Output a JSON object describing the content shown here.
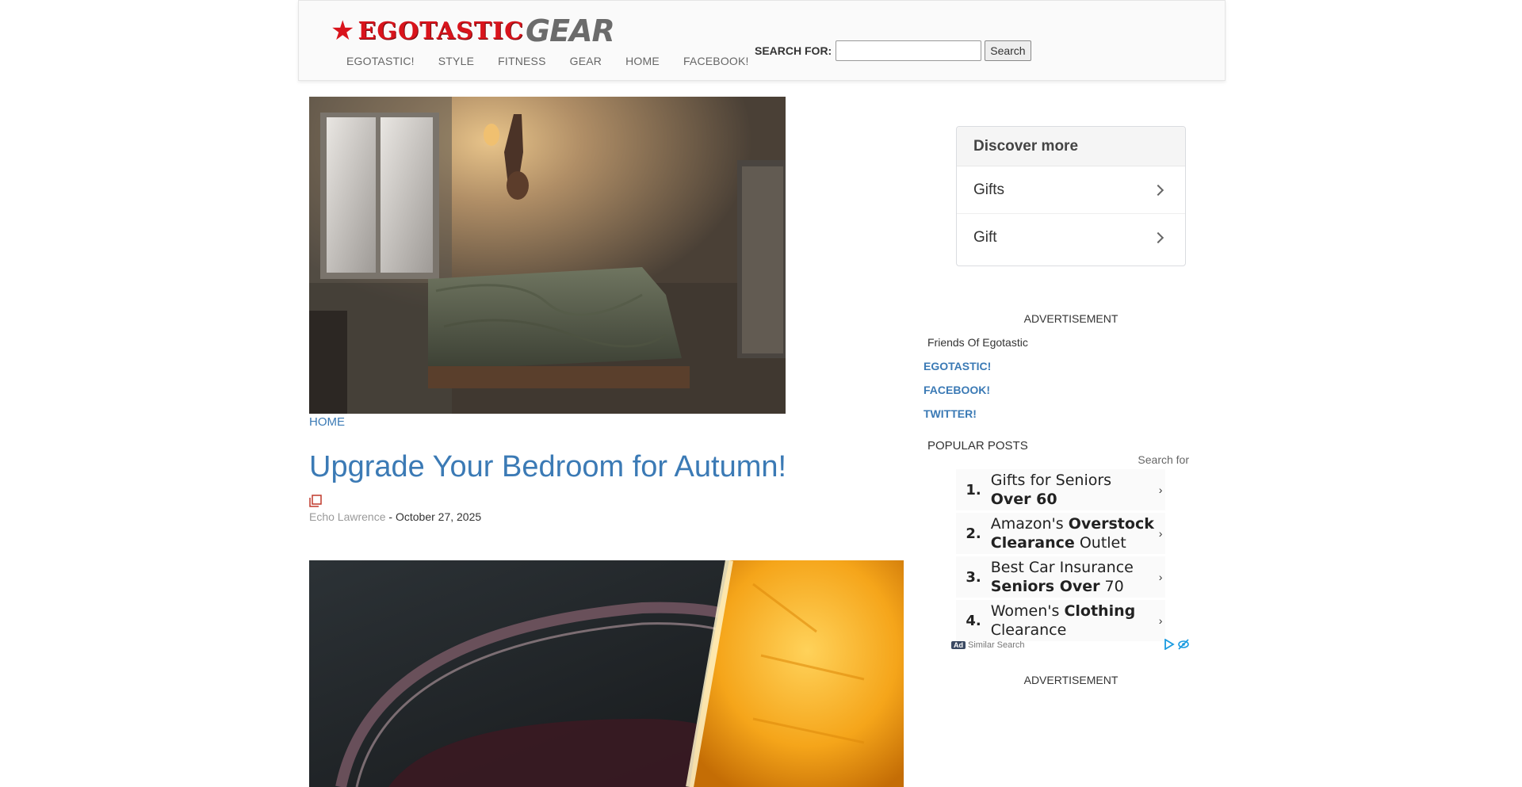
{
  "header": {
    "logo_ego": "EGOTASTIC",
    "logo_gear": "GEAR",
    "nav": [
      "EGOTASTIC!",
      "STYLE",
      "FITNESS",
      "GEAR",
      "HOME",
      "FACEBOOK!"
    ],
    "search_label": "SEARCH FOR:",
    "search_value": "",
    "search_button": "Search"
  },
  "article": {
    "category": "HOME",
    "title": "Upgrade Your Bedroom for Autumn!",
    "author": "Echo Lawrence",
    "date_sep": " - ",
    "date": "October 27, 2025"
  },
  "sidebar": {
    "discover_title": "Discover more",
    "discover_items": [
      "Gifts",
      "Gift"
    ],
    "advertisement_label": "ADVERTISEMENT",
    "friends_title": "Friends Of Egotastic",
    "links": [
      "EGOTASTIC!",
      "FACEBOOK!",
      "TWITTER!"
    ],
    "popular_title": "POPULAR POSTS",
    "search_for": "Search for",
    "ads": [
      {
        "num": "1.",
        "html": "Gifts for Seniors <b>Over 60</b>"
      },
      {
        "num": "2.",
        "html": "Amazon's <b>Overstock Clearance</b> Outlet"
      },
      {
        "num": "3.",
        "html": "Best Car Insurance <b>Seniors Over</b> 70"
      },
      {
        "num": "4.",
        "html": "Women's <b>Clothing</b> Clearance"
      }
    ],
    "ad_badge": "Ad",
    "similar_search": "Similar Search",
    "advertisement_label_2": "ADVERTISEMENT"
  }
}
